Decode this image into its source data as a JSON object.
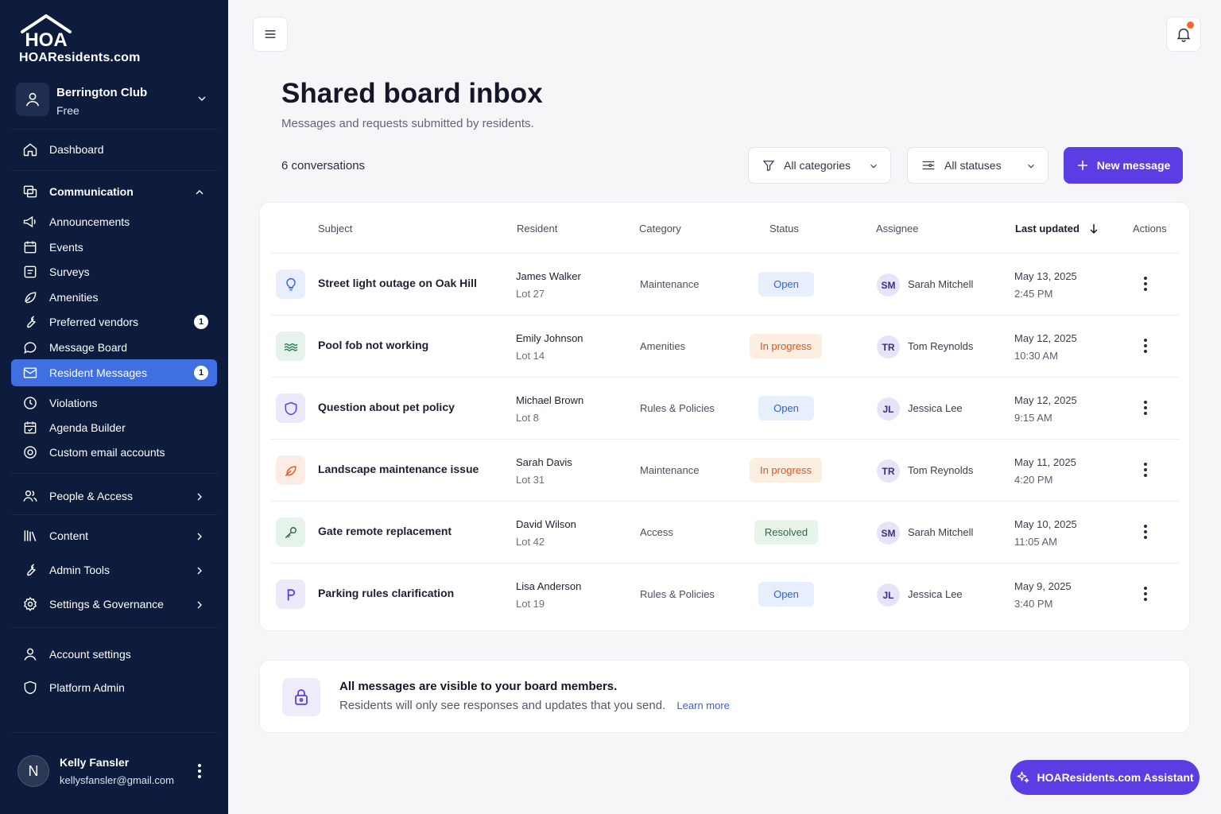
{
  "brand": {
    "logo_mark": "HOA",
    "name": "HOAResidents.com"
  },
  "org": {
    "name": "Berrington Club",
    "plan": "Free"
  },
  "nav": {
    "dashboard": "Dashboard",
    "communication": "Communication",
    "announcements": "Announcements",
    "events": "Events",
    "surveys": "Surveys",
    "amenities": "Amenities",
    "preferred_vendors": "Preferred vendors",
    "preferred_vendors_badge": "1",
    "message_board": "Message Board",
    "resident_messages": "Resident Messages",
    "resident_messages_badge": "1",
    "violations": "Violations",
    "agenda_builder": "Agenda Builder",
    "custom_email": "Custom email accounts",
    "people_access": "People & Access",
    "content": "Content",
    "admin_tools": "Admin Tools",
    "settings_governance": "Settings & Governance",
    "account_settings": "Account settings",
    "platform_admin": "Platform Admin"
  },
  "user": {
    "initial": "N",
    "name": "Kelly Fansler",
    "email": "kellysfansler@gmail.com"
  },
  "page": {
    "title": "Shared board inbox",
    "subtitle": "Messages and requests submitted by residents.",
    "count": "6 conversations"
  },
  "filters": {
    "categories": "All categories",
    "statuses": "All statuses"
  },
  "new_message_label": "New message",
  "table": {
    "headers": {
      "subject": "Subject",
      "resident": "Resident",
      "category": "Category",
      "status": "Status",
      "assignee": "Assignee",
      "last_updated": "Last updated",
      "actions": "Actions"
    },
    "rows": [
      {
        "icon": "lightbulb-icon",
        "subject": "Street light outage on Oak Hill",
        "resident": "James Walker",
        "lot": "Lot 27",
        "category": "Maintenance",
        "status": "Open",
        "assignee_initials": "SM",
        "assignee": "Sarah Mitchell",
        "date": "May 13, 2025",
        "time": "2:45 PM"
      },
      {
        "icon": "pool-waves-icon",
        "subject": "Pool fob not working",
        "resident": "Emily Johnson",
        "lot": "Lot 14",
        "category": "Amenities",
        "status": "In progress",
        "assignee_initials": "TR",
        "assignee": "Tom Reynolds",
        "date": "May 12, 2025",
        "time": "10:30 AM"
      },
      {
        "icon": "shield-icon",
        "subject": "Question about pet policy",
        "resident": "Michael Brown",
        "lot": "Lot 8",
        "category": "Rules & Policies",
        "status": "Open",
        "assignee_initials": "JL",
        "assignee": "Jessica Lee",
        "date": "May 12, 2025",
        "time": "9:15 AM"
      },
      {
        "icon": "leaf-icon",
        "subject": "Landscape maintenance issue",
        "resident": "Sarah Davis",
        "lot": "Lot 31",
        "category": "Maintenance",
        "status": "In progress",
        "assignee_initials": "TR",
        "assignee": "Tom Reynolds",
        "date": "May 11, 2025",
        "time": "4:20 PM"
      },
      {
        "icon": "key-icon",
        "subject": "Gate remote replacement",
        "resident": "David Wilson",
        "lot": "Lot 42",
        "category": "Access",
        "status": "Resolved",
        "assignee_initials": "SM",
        "assignee": "Sarah Mitchell",
        "date": "May 10, 2025",
        "time": "11:05 AM"
      },
      {
        "icon": "parking-icon",
        "subject": "Parking rules clarification",
        "resident": "Lisa Anderson",
        "lot": "Lot 19",
        "category": "Rules & Policies",
        "status": "Open",
        "assignee_initials": "JL",
        "assignee": "Jessica Lee",
        "date": "May 9, 2025",
        "time": "3:40 PM"
      }
    ]
  },
  "info": {
    "title": "All messages are visible to your board members.",
    "text": "Residents will only see responses and updates that you send.",
    "link": "Learn more"
  },
  "assistant_label": "HOAResidents.com Assistant",
  "colors": {
    "sidebar": "#0d1c3d",
    "active": "#3f6fe0",
    "primary": "#5b3de3",
    "notification": "#f26a2b"
  }
}
